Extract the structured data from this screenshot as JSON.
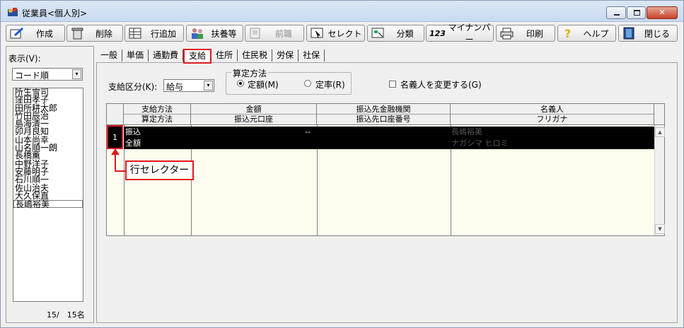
{
  "window": {
    "title": "従業員<個人別>",
    "close_symbol": "✕"
  },
  "toolbar": [
    {
      "label": "作成",
      "icon": "create-icon",
      "enabled": true
    },
    {
      "label": "削除",
      "icon": "delete-icon",
      "enabled": true
    },
    {
      "label": "行追加",
      "icon": "add-row-icon",
      "enabled": true
    },
    {
      "label": "扶養等",
      "icon": "dependents-icon",
      "enabled": true
    },
    {
      "label": "前職",
      "icon": "previous-job-icon",
      "enabled": false
    },
    {
      "label": "セレクト",
      "icon": "select-icon",
      "enabled": true
    },
    {
      "label": "分類",
      "icon": "classify-icon",
      "enabled": true
    },
    {
      "label": "マイナンバー",
      "icon": "my-number-icon",
      "prefix": "123",
      "enabled": true
    },
    {
      "label": "印刷",
      "icon": "print-icon",
      "enabled": true
    },
    {
      "label": "ヘルプ",
      "icon": "help-icon",
      "enabled": true
    },
    {
      "label": "閉じる",
      "icon": "close-door-icon",
      "enabled": true
    }
  ],
  "left": {
    "display_label": "表示(V):",
    "sort_value": "コード順",
    "dropdown_symbol": "▾",
    "employees": [
      "所生雪司",
      "窪田孝子",
      "田所耕太郎",
      "竹田辰治",
      "島海清一",
      "卯月良知",
      "山本尚幸",
      "山名順一朗",
      "長橋薫",
      "中野洋子",
      "安藤明子",
      "石川順一",
      "佐山治夫",
      "大久保直",
      "長嶋裕美"
    ],
    "selected_index": 14,
    "count_text": "15/　15名"
  },
  "tabs": [
    "一般",
    "単価",
    "通勤費",
    "支給",
    "住所",
    "住民税",
    "労保",
    "社保"
  ],
  "active_tab": 3,
  "form": {
    "kubun_label": "支給区分(K):",
    "kubun_value": "給与",
    "method_group_title": "算定方法",
    "radio_fixed": "定額(M)",
    "radio_rate": "定率(R)",
    "checkbox_label": "名義人を変更する(G)"
  },
  "grid": {
    "headers": [
      {
        "top": "支給方法",
        "bottom": "算定方法"
      },
      {
        "top": "金額",
        "bottom": "振込元口座"
      },
      {
        "top": "振込先金融機関",
        "bottom": "振込先口座番号"
      },
      {
        "top": "名義人",
        "bottom": "フリガナ"
      }
    ],
    "rows": [
      {
        "number": "1",
        "method": "振込",
        "calc": "全額",
        "amount": "--",
        "from_account": "",
        "bank": "",
        "account_no": "",
        "holder": "長嶋裕美",
        "kana": "ナガシマ ヒロミ"
      }
    ],
    "scroll_up": "▲",
    "scroll_down": "▼"
  },
  "callout": {
    "text": "行セレクター"
  },
  "colors": {
    "highlight": "#e0191f",
    "grid_bg": "#fffdf0"
  }
}
